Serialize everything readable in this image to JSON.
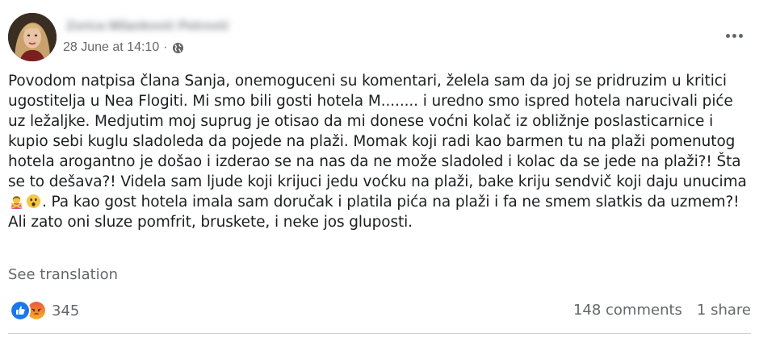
{
  "post": {
    "author_name": "Zorica Milanković Petrović",
    "timestamp": "28 June at 14:10",
    "separator": "·",
    "privacy_icon": "globe-icon",
    "more_icon": "more-options-icon",
    "body_part1": "Povodom natpisa člana Sanja, onemoguceni su komentari, želela sam da joj se pridruzim u kritici ugostitelja u Nea Flogiti. Mi smo bili gosti hotela M........ i uredno smo ispred hotela narucivali piće uz ležaljke. Medjutim moj suprug je otisao da mi donese voćni kolač iz obližnje poslasticarnice i kupio sebi kuglu sladoleda da pojede na plaži. Momak koji radi kao barmen tu na plaži pomenutog hotela arogantno je došao i izderao se na nas da ne može sladoled i kolac da se jede na plaži?! Šta se to dešava?! Videla sam ljude koji krijuci jedu voćku na plaži, bake kriju sendvič koji daju unucima",
    "body_part2": ". Pa kao gost hotela imala sam doručak i platila pića na plaži i fa ne smem slatkis da uzmem?! Ali zato oni sluze pomfrit, bruskete, i neke jos gluposti.",
    "inline_emojis": [
      "woman-gesturing-no-emoji",
      "astonished-face-emoji"
    ],
    "see_translation": "See translation"
  },
  "reactions": {
    "icons": [
      "like-icon",
      "angry-icon"
    ],
    "count": "345",
    "like_color": "#1877f2",
    "angry_color": "#e9710f"
  },
  "stats": {
    "comments": "148 comments",
    "shares": "1 share"
  }
}
